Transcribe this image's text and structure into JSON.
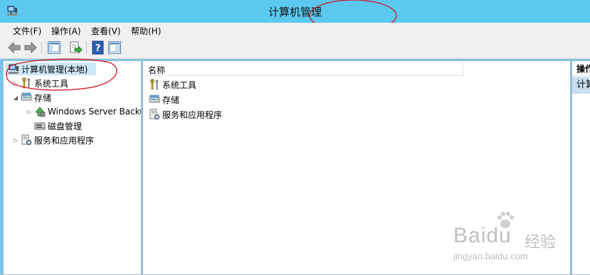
{
  "window": {
    "title": "计算机管理"
  },
  "menubar": {
    "items": [
      "文件(F)",
      "操作(A)",
      "查看(V)",
      "帮助(H)"
    ]
  },
  "toolbar": {
    "buttons": [
      "back-icon",
      "forward-icon",
      "show-hide-console-tree-icon",
      "export-list-icon",
      "help-icon",
      "show-hide-action-pane-icon"
    ]
  },
  "tree": {
    "root": "计算机管理(本地)",
    "items": [
      {
        "label": "系统工具",
        "icon": "tools-icon",
        "expander": "▷"
      },
      {
        "label": "存储",
        "icon": "storage-icon",
        "expander": "◢"
      },
      {
        "label": "Windows Server Backup",
        "icon": "backup-icon",
        "expander": "▷"
      },
      {
        "label": "磁盘管理",
        "icon": "disk-management-icon",
        "expander": ""
      },
      {
        "label": "服务和应用程序",
        "icon": "services-icon",
        "expander": "▷"
      }
    ]
  },
  "list": {
    "column_name": "名称",
    "rows": [
      "系统工具",
      "存储",
      "服务和应用程序"
    ]
  },
  "actions": {
    "header": "操作",
    "item": "计算机管理"
  },
  "watermark": {
    "brand": "Baidu",
    "cn": "经验",
    "url": "jingyan.baidu.com"
  },
  "colors": {
    "titlebar": "#5bc8ef",
    "annotation": "#d0141e",
    "frame": "#7ac6ea"
  }
}
